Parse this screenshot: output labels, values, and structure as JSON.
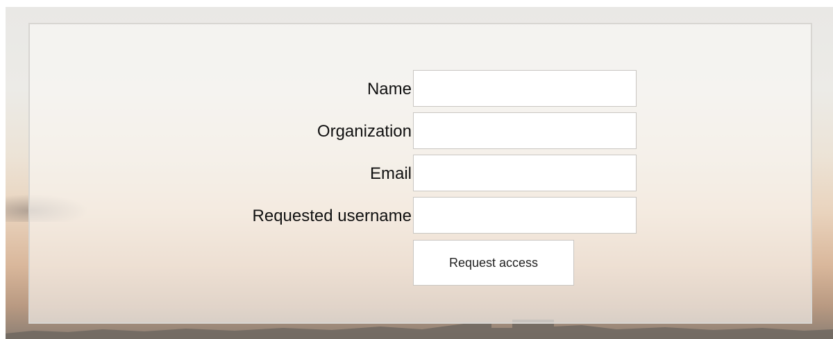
{
  "form": {
    "fields": [
      {
        "label": "Name",
        "value": "",
        "placeholder": ""
      },
      {
        "label": "Organization",
        "value": "",
        "placeholder": ""
      },
      {
        "label": "Email",
        "value": "",
        "placeholder": ""
      },
      {
        "label": "Requested username",
        "value": "",
        "placeholder": ""
      }
    ],
    "submit_label": "Request access"
  },
  "colors": {
    "panel_border": "#d8d6d2",
    "field_border": "#c9c6c2",
    "text": "#111111"
  }
}
